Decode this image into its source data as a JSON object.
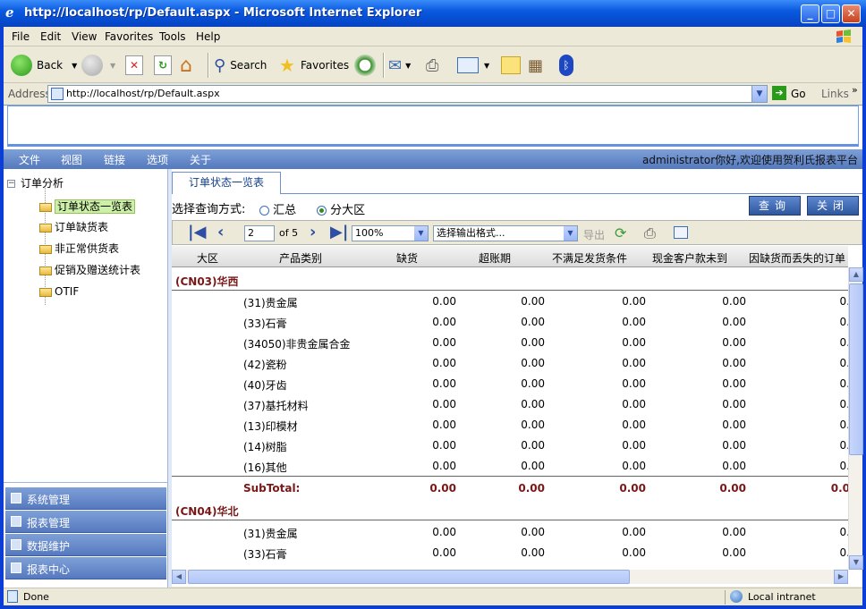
{
  "window": {
    "title": "http://localhost/rp/Default.aspx - Microsoft Internet Explorer",
    "buttons": {
      "minimize": "_",
      "maximize": "□",
      "close": "✕"
    }
  },
  "menubar": {
    "items": [
      "File",
      "Edit",
      "View",
      "Favorites",
      "Tools",
      "Help"
    ]
  },
  "toolbar": {
    "back": "Back",
    "search": "Search",
    "favorites": "Favorites"
  },
  "address": {
    "label": "Address",
    "url": "http://localhost/rp/Default.aspx",
    "go": "Go",
    "links": "Links"
  },
  "topnav": {
    "items": [
      "文件",
      "视图",
      "链接",
      "选项",
      "关于"
    ],
    "welcome": "administrator你好,欢迎使用贺利氏报表平台"
  },
  "tree": {
    "root": "订单分析",
    "nodes": [
      "订单状态一览表",
      "订单缺货表",
      "非正常供货表",
      "促销及赠送统计表",
      "OTIF"
    ]
  },
  "accordion": [
    "系统管理",
    "报表管理",
    "数据维护",
    "报表中心"
  ],
  "tab": {
    "label": "订单状态一览表"
  },
  "query": {
    "label": "选择查询方式:",
    "options": [
      "汇总",
      "分大区"
    ],
    "selected": "分大区",
    "query_button": "查询",
    "close_button": "关闭"
  },
  "report_toolbar": {
    "page": "2",
    "of_pages": "of 5",
    "zoom": "100%",
    "export_format": "选择输出格式...",
    "export": "导出"
  },
  "grid": {
    "columns": [
      "大区",
      "产品类别",
      "缺货",
      "超账期",
      "不满足发货条件",
      "现金客户款未到",
      "因缺货而丢失的订单"
    ],
    "groups": [
      {
        "region": "(CN03)华西",
        "rows": [
          {
            "category": "(31)贵金属",
            "values": [
              "0.00",
              "0.00",
              "0.00",
              "0.00",
              "0."
            ]
          },
          {
            "category": "(33)石膏",
            "values": [
              "0.00",
              "0.00",
              "0.00",
              "0.00",
              "0."
            ]
          },
          {
            "category": "(34050)非贵金属合金",
            "values": [
              "0.00",
              "0.00",
              "0.00",
              "0.00",
              "0."
            ]
          },
          {
            "category": "(42)瓷粉",
            "values": [
              "0.00",
              "0.00",
              "0.00",
              "0.00",
              "0."
            ]
          },
          {
            "category": "(40)牙齿",
            "values": [
              "0.00",
              "0.00",
              "0.00",
              "0.00",
              "0."
            ]
          },
          {
            "category": "(37)基托材料",
            "values": [
              "0.00",
              "0.00",
              "0.00",
              "0.00",
              "0."
            ]
          },
          {
            "category": "(13)印模材",
            "values": [
              "0.00",
              "0.00",
              "0.00",
              "0.00",
              "0."
            ]
          },
          {
            "category": "(14)树脂",
            "values": [
              "0.00",
              "0.00",
              "0.00",
              "0.00",
              "0."
            ]
          },
          {
            "category": "(16)其他",
            "values": [
              "0.00",
              "0.00",
              "0.00",
              "0.00",
              "0."
            ]
          }
        ],
        "subtotal": {
          "label": "SubTotal:",
          "values": [
            "0.00",
            "0.00",
            "0.00",
            "0.00",
            "0.0"
          ]
        }
      },
      {
        "region": "(CN04)华北",
        "rows": [
          {
            "category": "(31)贵金属",
            "values": [
              "0.00",
              "0.00",
              "0.00",
              "0.00",
              "0."
            ]
          },
          {
            "category": "(33)石膏",
            "values": [
              "0.00",
              "0.00",
              "0.00",
              "0.00",
              "0."
            ]
          }
        ]
      }
    ]
  },
  "status": {
    "text": "Done",
    "zone": "Local intranet"
  }
}
